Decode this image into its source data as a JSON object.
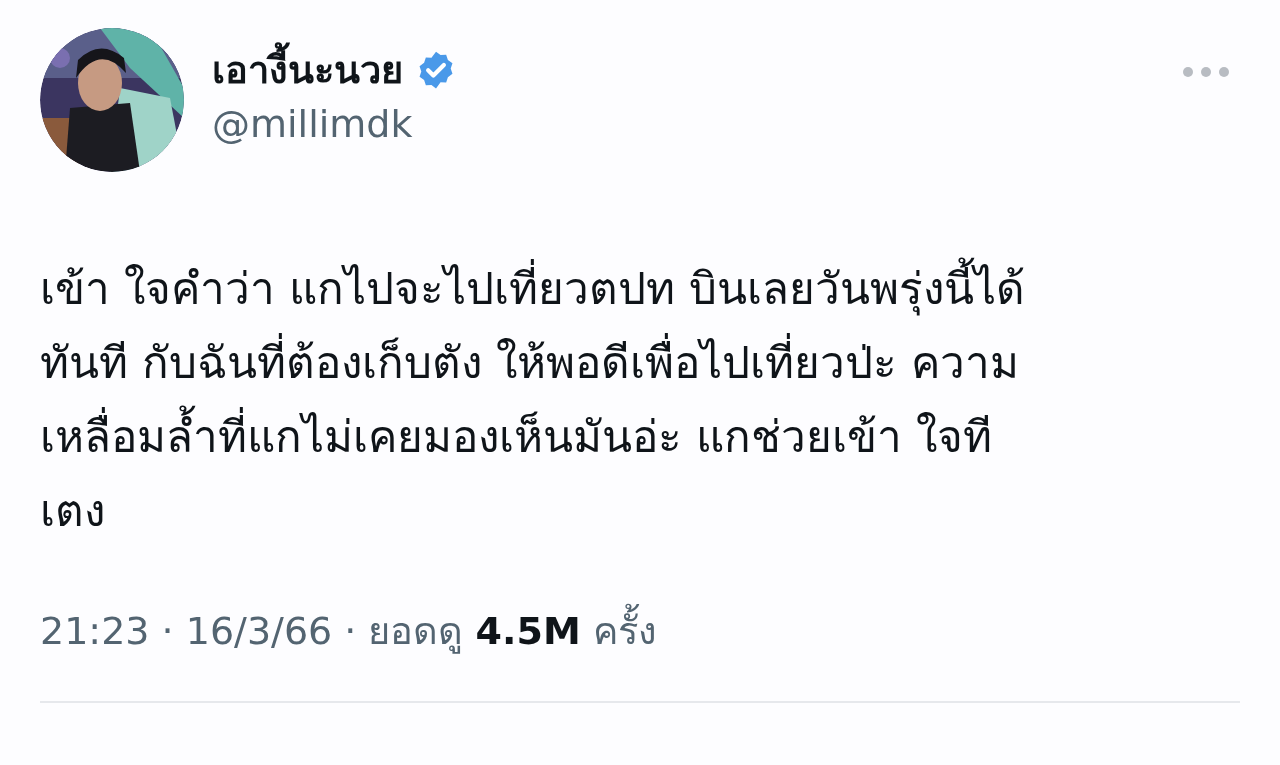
{
  "author": {
    "display_name": "เอางี้นะนวย",
    "verified": true,
    "handle": "@millimdk"
  },
  "tweet": {
    "text_lines": [
      "เข้า ใจคำว่า แกไปจะไปเที่ยวตปท บินเลยวันพรุ่งนี้ได้",
      "ทันที กับฉันที่ต้องเก็บตัง ให้พอดีเพื่อไปเที่ยวป่ะ ความ",
      "เหลื่อมล้ำที่แกไม่เคยมองเห็นมันอ่ะ  แกช่วยเข้า ใจที",
      "เตง"
    ],
    "meta": "21:23 · 16/3/66 · ยอดดู **4.5M** ครั้ง"
  }
}
